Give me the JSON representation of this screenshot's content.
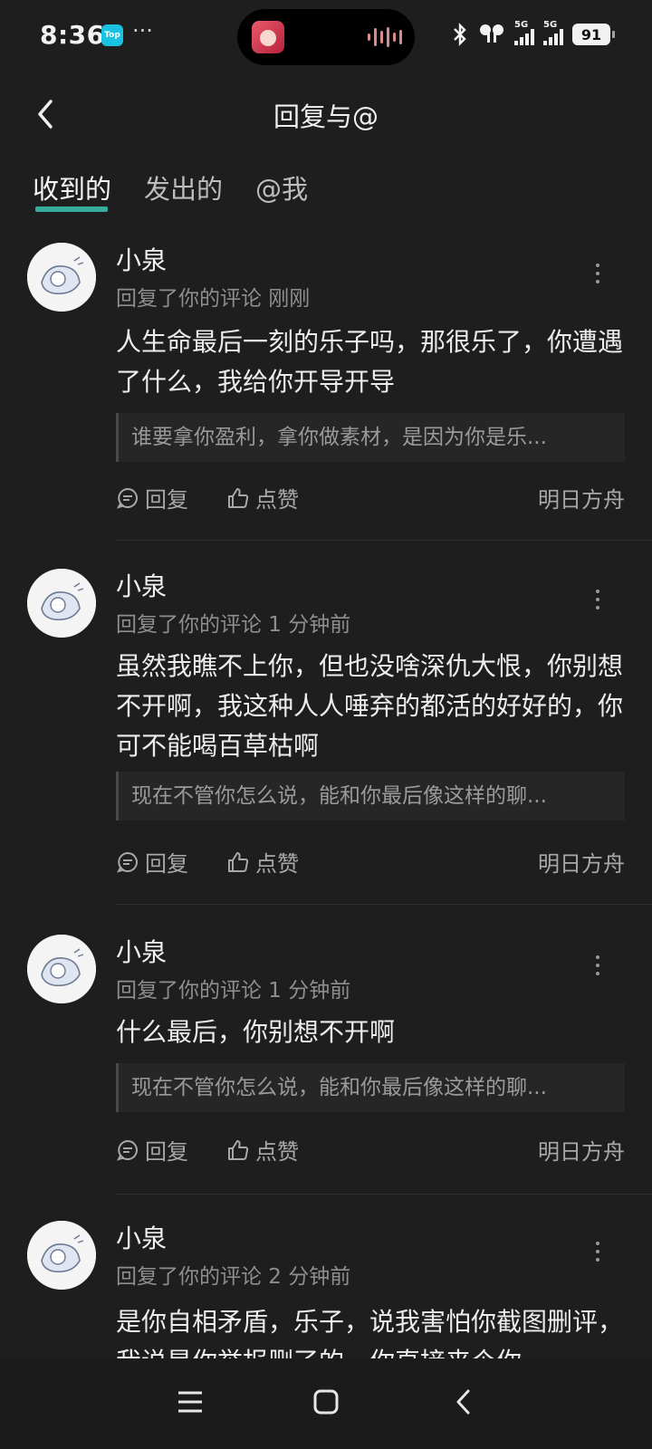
{
  "status_bar": {
    "time": "8:36",
    "app_icon_label": "Top",
    "more": "···",
    "battery": "91",
    "signal_tag_1": "5G",
    "signal_tag_2": "5G"
  },
  "header": {
    "title": "回复与@"
  },
  "tabs": [
    {
      "label": "收到的",
      "active": true
    },
    {
      "label": "发出的",
      "active": false
    },
    {
      "label": "@我",
      "active": false
    }
  ],
  "items": [
    {
      "name": "小泉",
      "meta": "回复了你的评论 刚刚",
      "content": "人生命最后一刻的乐子吗，那很乐了，你遭遇了什么，我给你开导开导",
      "quote": "谁要拿你盈利，拿你做素材，是因为你是乐...",
      "reply": "回复",
      "like": "点赞",
      "source": "明日方舟"
    },
    {
      "name": "小泉",
      "meta": "回复了你的评论 1 分钟前",
      "content": "虽然我瞧不上你，但也没啥深仇大恨，你别想不开啊，我这种人人唾弃的都活的好好的，你可不能喝百草枯啊",
      "quote": "现在不管你怎么说，能和你最后像这样的聊...",
      "reply": "回复",
      "like": "点赞",
      "source": "明日方舟"
    },
    {
      "name": "小泉",
      "meta": "回复了你的评论 1 分钟前",
      "content": "什么最后，你别想不开啊",
      "quote": "现在不管你怎么说，能和你最后像这样的聊...",
      "reply": "回复",
      "like": "点赞",
      "source": "明日方舟"
    },
    {
      "name": "小泉",
      "meta": "回复了你的评论 2 分钟前",
      "content": "是你自相矛盾，乐子，说我害怕你截图删评，我说是你举报删了的，你直接来个你"
    }
  ],
  "colors": {
    "background": "#1e1e1e",
    "accent": "#3dc5b4"
  }
}
